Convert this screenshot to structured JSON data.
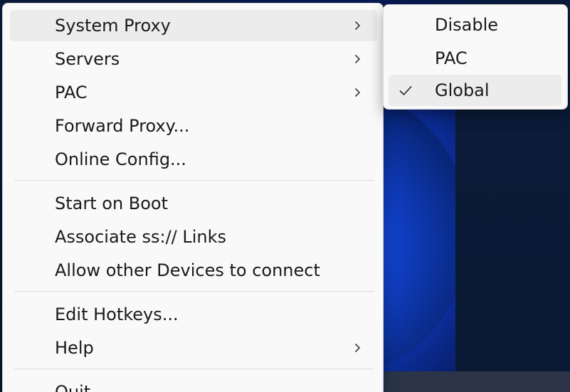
{
  "menu": {
    "items": [
      {
        "label": "System Proxy",
        "submenu": true
      },
      {
        "label": "Servers",
        "submenu": true
      },
      {
        "label": "PAC",
        "submenu": true
      },
      {
        "label": "Forward Proxy...",
        "submenu": false
      },
      {
        "label": "Online Config...",
        "submenu": false
      },
      {
        "label": "Start on Boot",
        "submenu": false
      },
      {
        "label": "Associate ss:// Links",
        "submenu": false
      },
      {
        "label": "Allow other Devices to connect",
        "submenu": false
      },
      {
        "label": "Edit Hotkeys...",
        "submenu": false
      },
      {
        "label": "Help",
        "submenu": true
      },
      {
        "label": "Quit",
        "submenu": false
      }
    ]
  },
  "system_proxy_submenu": {
    "items": [
      {
        "label": "Disable"
      },
      {
        "label": "PAC"
      },
      {
        "label": "Global",
        "checked": true
      }
    ]
  },
  "icons": {
    "submenu_arrow": "chevron-right-icon",
    "checked": "checkmark-icon"
  },
  "colors": {
    "menu_background": "#f9f9f9",
    "highlight": "#ececec",
    "text": "#1a1a1a",
    "wallpaper_accent": "#1a4fd0"
  }
}
